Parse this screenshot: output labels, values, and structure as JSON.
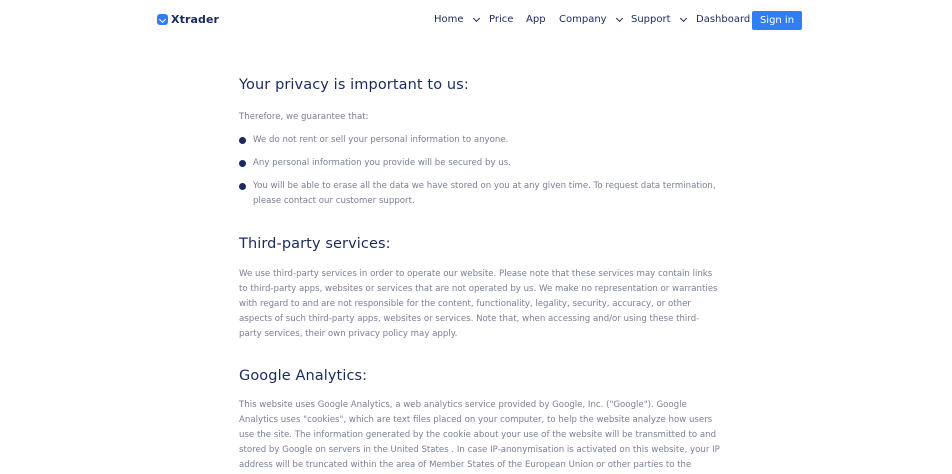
{
  "nav": {
    "brand": "Xtrader",
    "items": [
      {
        "label": "Home",
        "dropdown": true
      },
      {
        "label": "Price",
        "dropdown": false
      },
      {
        "label": "App",
        "dropdown": false
      },
      {
        "label": "Company",
        "dropdown": true
      },
      {
        "label": "Support",
        "dropdown": true
      },
      {
        "label": "Dashboard",
        "dropdown": false
      }
    ],
    "signin_label": "Sign in"
  },
  "sections": {
    "privacy": {
      "title": "Your privacy is important to us:",
      "intro": "Therefore, we guarantee that:",
      "bullets": [
        "We do not rent or sell your personal information to anyone.",
        "Any personal information you provide will be secured by us.",
        "You will be able to erase all the data we have stored on you at any given time. To request data termination, please contact our customer support."
      ]
    },
    "third_party": {
      "title": "Third-party services:",
      "body": "We use third-party services in order to operate our website. Please note that these services may contain links to third-party apps, websites or services that are not operated by us. We make no representation or warranties with regard to and are not responsible for the content, functionality, legality, security, accuracy, or other aspects of such third-party apps, websites or services. Note that, when accessing and/or using these third-party services, their own privacy policy may apply."
    },
    "analytics": {
      "title": "Google Analytics:",
      "body": "This website uses Google Analytics, a web analytics service provided by Google, Inc. (\"Google\"). Google Analytics uses \"cookies\", which are text files placed on your computer, to help the website analyze how users use the site. The information generated by the cookie about your use of the website will be transmitted to and stored by Google on servers in the United States . In case IP-anonymisation is activated on this website, your IP address will be truncated within the area of Member States of the European Union or other parties to the Agreement on"
    }
  },
  "colors": {
    "accent": "#2f7ef4",
    "heading": "#1b2a5e",
    "body_text": "#7a7f95"
  },
  "icons": {
    "logo": "brand-logo-icon",
    "dropdown": "chevron-down-icon",
    "bullet": "bullet-dot-icon"
  }
}
